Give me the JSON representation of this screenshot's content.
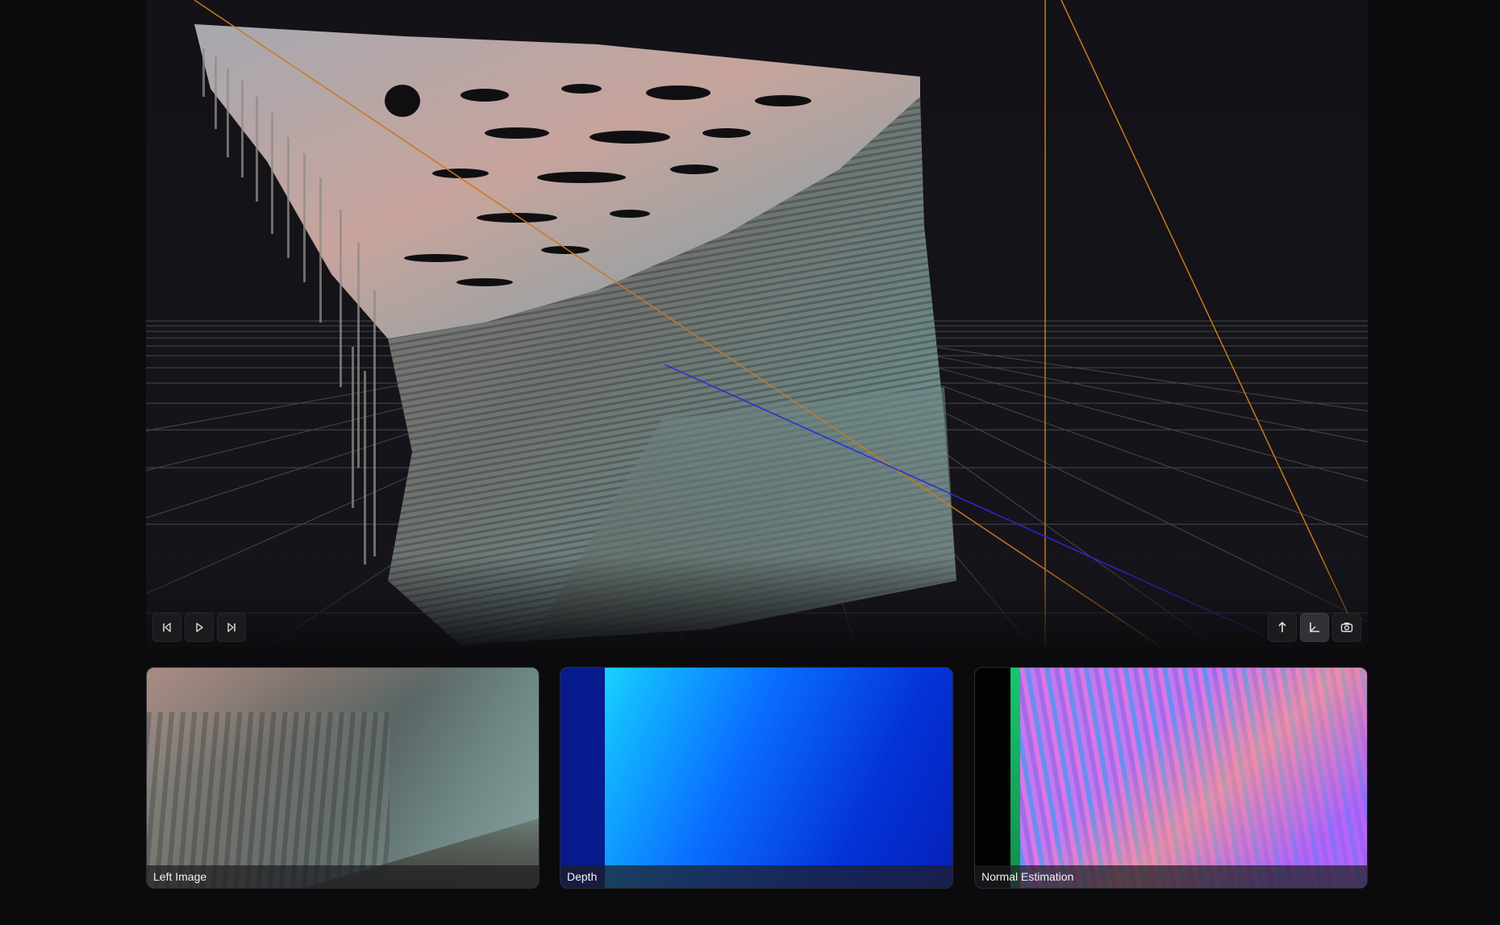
{
  "viewport": {
    "playback_controls": [
      {
        "name": "step-back-button",
        "icon": "step-back-icon"
      },
      {
        "name": "play-button",
        "icon": "play-icon"
      },
      {
        "name": "step-forward-button",
        "icon": "step-forward-icon"
      }
    ],
    "view_controls": [
      {
        "name": "up-axis-button",
        "icon": "arrow-up-icon"
      },
      {
        "name": "axes-toggle-button",
        "icon": "axes-icon",
        "active": true
      },
      {
        "name": "camera-view-button",
        "icon": "camera-icon"
      }
    ],
    "colors": {
      "background": "#131217",
      "grid": "#5a5a62",
      "axis_orange": "#c77a1a",
      "axis_blue": "#2a2ad8"
    }
  },
  "panels": {
    "left_image": {
      "label": "Left Image"
    },
    "depth": {
      "label": "Depth"
    },
    "normal_estimation": {
      "label": "Normal Estimation"
    }
  }
}
